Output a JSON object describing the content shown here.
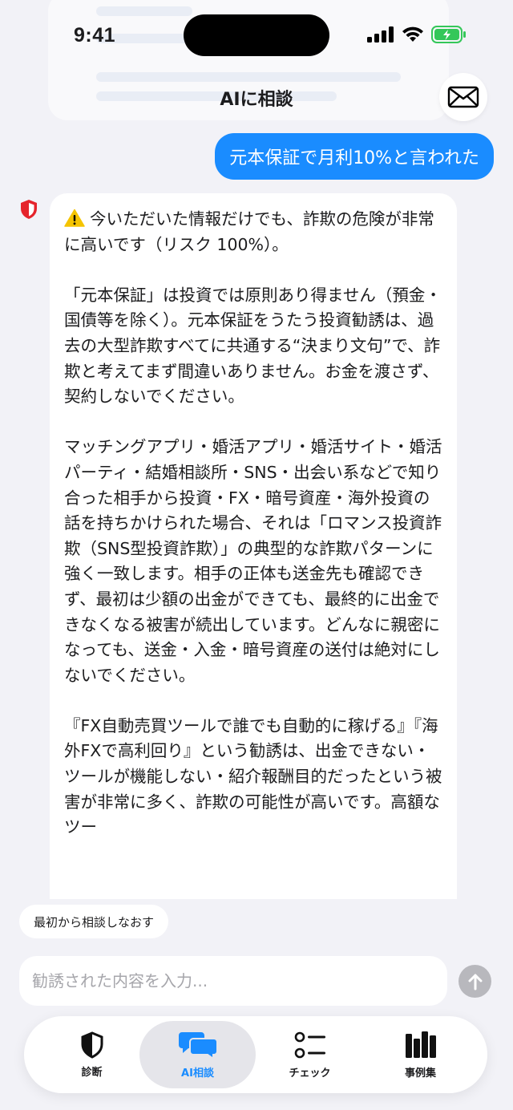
{
  "status_bar": {
    "time": "9:41"
  },
  "header": {
    "title": "AIに相談"
  },
  "chat": {
    "user_message": "元本保証で月利10%と言われた",
    "bot_paragraphs": [
      "今いただいた情報だけでも、詐欺の危険が非常に高いです（リスク 100%）。",
      "「元本保証」は投資では原則あり得ません（預金・国債等を除く）。元本保証をうたう投資勧誘は、過去の大型詐欺すべてに共通する“決まり文句”で、詐欺と考えてまず間違いありません。お金を渡さず、契約しないでください。",
      "マッチングアプリ・婚活アプリ・婚活サイト・婚活パーティ・結婚相談所・SNS・出会い系などで知り合った相手から投資・FX・暗号資産・海外投資の話を持ちかけられた場合、それは「ロマンス投資詐欺（SNS型投資詐欺）」の典型的な詐欺パターンに強く一致します。相手の正体も送金先も確認できず、最初は少額の出金ができても、最終的に出金できなくなる被害が続出しています。どんなに親密になっても、送金・入金・暗号資産の送付は絶対にしないでください。",
      "『FX自動売買ツールで誰でも自動的に稼げる』『海外FXで高利回り』という勧誘は、出金できない・ツールが機能しない・紹介報酬目的だったという被害が非常に多く、詐欺の可能性が高いです。高額なツー"
    ]
  },
  "restart_label": "最初から相談しなおす",
  "composer": {
    "placeholder": "勧誘された内容を入力..."
  },
  "tabs": [
    {
      "label": "診断",
      "icon": "shield-icon"
    },
    {
      "label": "AI相談",
      "icon": "chat-bubbles-icon"
    },
    {
      "label": "チェック",
      "icon": "checklist-icon"
    },
    {
      "label": "事例集",
      "icon": "books-icon"
    }
  ],
  "colors": {
    "accent": "#1a8cff",
    "warning_shield": "#e5242c",
    "battery": "#34c759"
  }
}
